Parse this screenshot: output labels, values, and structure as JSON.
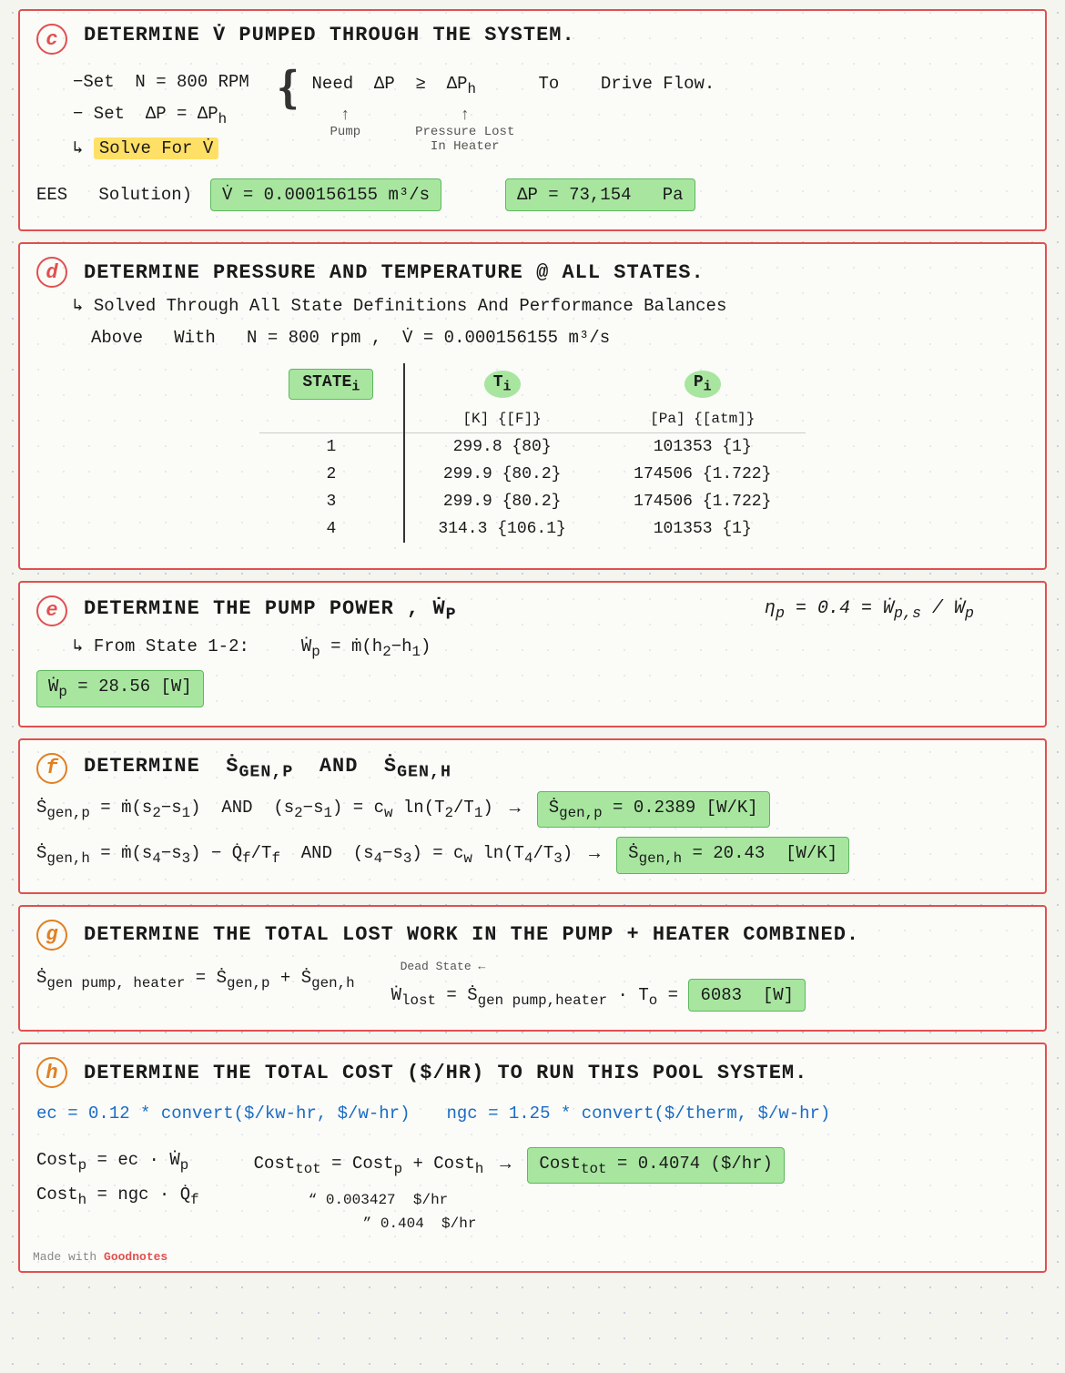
{
  "sections": {
    "c": {
      "label": "c",
      "title": "Determine V̇ Pumped Through The System.",
      "lines": [
        "-Set N = 800 RPM",
        "-Set ΔP = ΔP_h",
        "↳ Solve For V̇",
        "NEED ΔP ≥ ΔP_h  TO  Drive Flow.",
        "PUMP",
        "PRESSURE LOST IN HEATER",
        "EES Solution)",
        "V̇ = 0.000156155 m³/s",
        "ΔP = 73,154  Pa"
      ]
    },
    "d": {
      "label": "d",
      "title": "Determine Pressure And Temperature @ All States.",
      "subtitle": "Solved Through All State Definitions And Performance Balances",
      "subtitle2": "Above  With  N = 800 rpm , V̇ = 0.000156155 m³/s",
      "table": {
        "col1_header": "STATE_i",
        "col2_header": "T_i",
        "col2_sub": "[K] {[F]}",
        "col3_header": "P_i",
        "col3_sub": "[Pa] {[atm]}",
        "rows": [
          {
            "state": "1",
            "T": "299.8 {80}",
            "P": "101353 {1}"
          },
          {
            "state": "2",
            "T": "299.9 {80.2}",
            "P": "174506 {1.722}"
          },
          {
            "state": "3",
            "T": "299.9 {80.2}",
            "P": "174506 {1.722}"
          },
          {
            "state": "4",
            "T": "314.3 {106.1}",
            "P": "101353 {1}"
          }
        ]
      }
    },
    "e": {
      "label": "e",
      "title": "Determine The Pump Power , Ẇ_p",
      "line1": "↳ From State 1-2:    Ẇ_p = ṁ(h₂-h₁)",
      "line2": "η_p = 0.4 = Ẇ_{p,s} / Ẇ_p",
      "result": "Ẇ_p = 28.56 [W]"
    },
    "f": {
      "label": "f",
      "title": "Determine Ṡ_gen,p  And  Ṡ_gen,h",
      "line1": "Ṡ_gen,p = ṁ(s₂-s₁)  AND  (s₂-s₁) = c_w ln(T₂/T₁)  →  Ṡ_gen,p = 0.2389 [W/K]",
      "line2": "Ṡ_gen,h = ṁ(s₄-s₃) - Q̇_f/T_f  AND  (s₄-s₃) = c_w ln(T₄/T₃)  →  Ṡ_gen,h = 20.43 [W/K]"
    },
    "g": {
      "label": "g",
      "title": "Determine The Total Lost Work In The Pump + Heater Combined.",
      "line1": "Ṡ_gen pump,heater = Ṡ_gen,p + Ṡ_gen,h",
      "line2": "Ẇ_lost = Ṡ_gen pump,heater · T_o = 6083 [W]",
      "dead_state": "Dead State ←"
    },
    "h": {
      "label": "h",
      "title": "Determine The Total Cost ($/hr) To Run This Pool System.",
      "line1": "ec = 0.12 * convert($/kw-hr, $/w-hr)",
      "line2": "ngc = 1.25 * convert($/therm, $/w-hr)",
      "line3": "Cost_p = ec · Ẇ_p",
      "line4": "Cost_h = ngc · Q̇_f",
      "line5": "Cost_tot = Cost_p + Cost_h  →  Cost_tot = 0.4074 ($/hr)",
      "line6": "0.003427 $/hr",
      "line7": "0.404 $/hr"
    }
  },
  "footer": {
    "made_with": "Made with",
    "app": "Goodnotes"
  }
}
